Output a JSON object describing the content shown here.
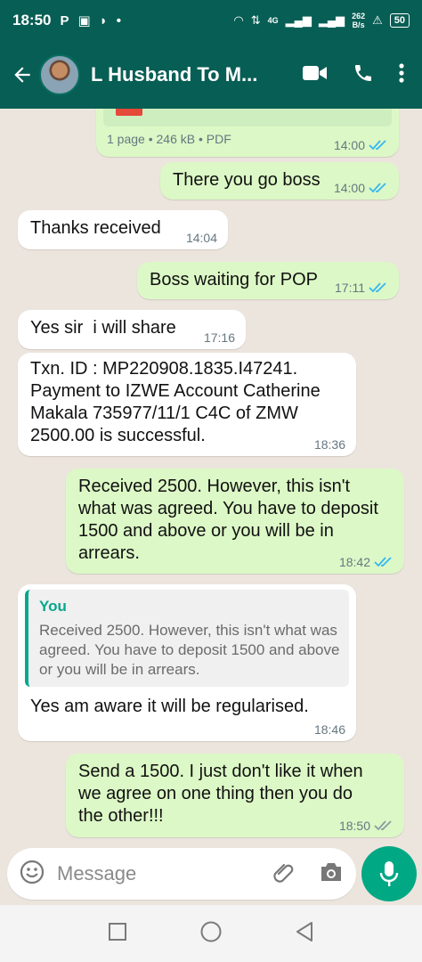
{
  "status_bar": {
    "time": "18:50",
    "network_speed_value": "262",
    "network_speed_unit": "B/s",
    "network_type": "4G",
    "battery": "50"
  },
  "header": {
    "contact_name": "L Husband To M..."
  },
  "messages": [
    {
      "direction": "out",
      "file_meta": "1 page • 246 kB • PDF",
      "time": "14:00",
      "ticks": "read"
    },
    {
      "direction": "out",
      "text": "There you go boss",
      "time": "14:00",
      "ticks": "read"
    },
    {
      "direction": "in",
      "text": "Thanks received",
      "time": "14:04"
    },
    {
      "direction": "out",
      "text": "Boss waiting for POP",
      "time": "17:11",
      "ticks": "read"
    },
    {
      "direction": "in",
      "text": "Yes sir  i will share",
      "time": "17:16"
    },
    {
      "direction": "in",
      "text": "Txn. ID : MP220908.1835.I47241. Payment to IZWE Account Catherine Makala 735977/11/1 C4C of ZMW 2500.00 is successful.",
      "time": "18:36"
    },
    {
      "direction": "out",
      "text": "Received 2500. However, this isn't what was agreed. You have to deposit 1500 and above or you will be in arrears.",
      "time": "18:42",
      "ticks": "read"
    },
    {
      "direction": "in",
      "quote_name": "You",
      "quote_text": "Received 2500. However, this isn't what was agreed. You have to deposit 1500 and above or you will be in arrears.",
      "text": "Yes am aware it will be regularised.",
      "time": "18:46"
    },
    {
      "direction": "out",
      "text": "Send a 1500. I just don't like it when we  agree on one thing then you do the other!!!",
      "time": "18:50",
      "ticks": "delivered"
    }
  ],
  "composer": {
    "placeholder": "Message"
  },
  "colors": {
    "header": "#075e54",
    "outgoing_bubble": "#dcf8c6",
    "incoming_bubble": "#ffffff",
    "read_ticks": "#34b7f1",
    "mic_button": "#00a884",
    "quote_accent": "#06a88c"
  },
  "icons": [
    "back-arrow-icon",
    "video-call-icon",
    "voice-call-icon",
    "more-options-icon",
    "emoji-icon",
    "attach-icon",
    "camera-icon",
    "mic-icon",
    "nav-recents-icon",
    "nav-home-icon",
    "nav-back-icon"
  ]
}
